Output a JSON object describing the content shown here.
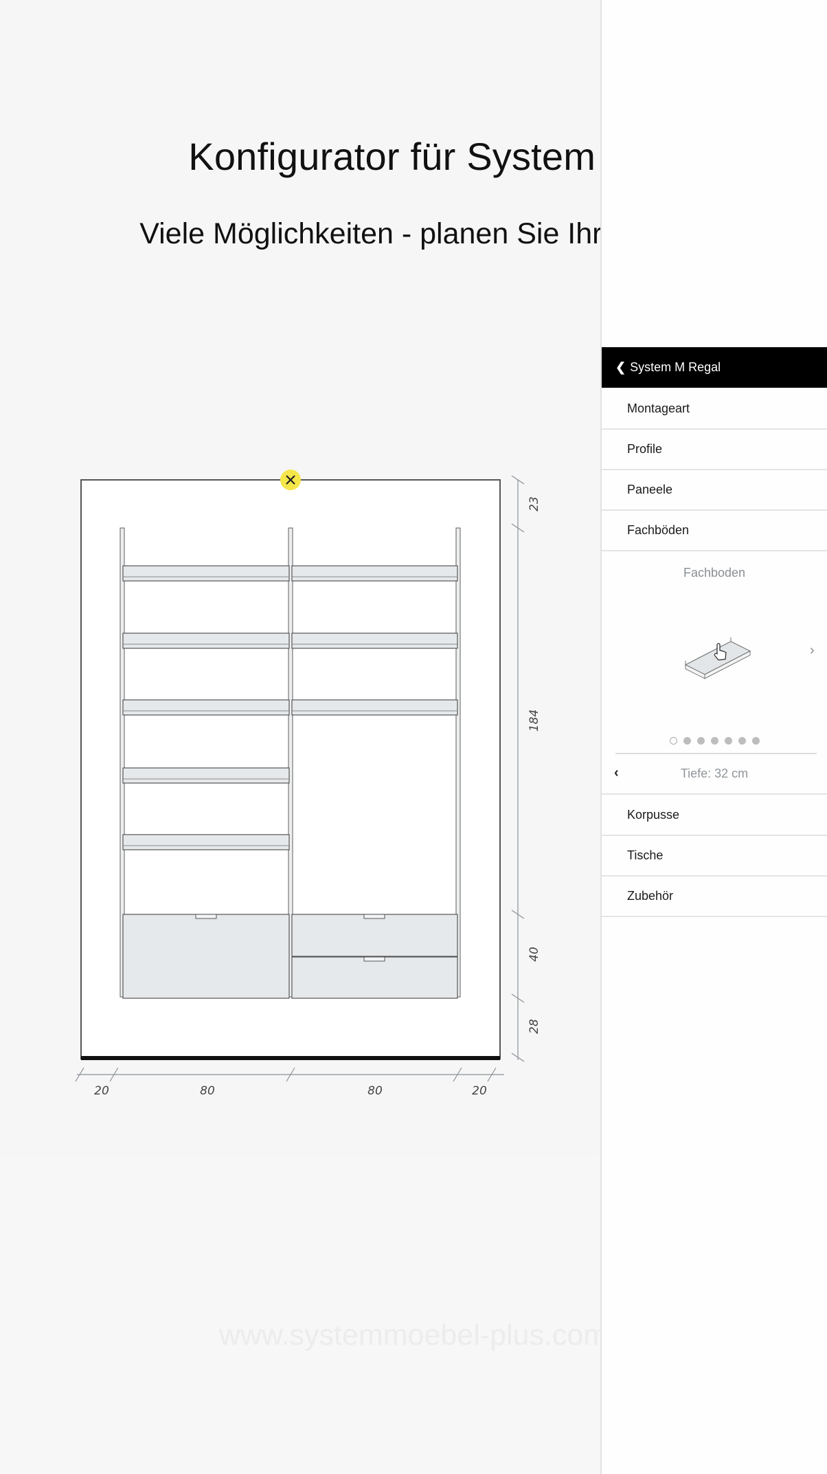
{
  "page": {
    "title": "Konfigurator für System M",
    "subtitle": "Viele Möglichkeiten - planen Sie Ihr Regal",
    "watermark": "www.systemmoebel-plus.com"
  },
  "sidebar": {
    "header": {
      "label": "System M Regal",
      "icon": "chevron-left-icon"
    },
    "items_top": [
      {
        "label": "Montageart"
      },
      {
        "label": "Profile"
      },
      {
        "label": "Paneele"
      },
      {
        "label": "Fachböden"
      }
    ],
    "detail": {
      "title": "Fachboden",
      "image": "shelf-board-icon",
      "next_icon": "chevron-right-icon",
      "carousel_total": 7,
      "carousel_active_index": 0
    },
    "depth": {
      "label": "Tiefe: 32 cm",
      "icon": "chevron-left-icon"
    },
    "items_bottom": [
      {
        "label": "Korpusse"
      },
      {
        "label": "Tische"
      },
      {
        "label": "Zubehör"
      }
    ]
  },
  "drawing": {
    "remove_icon": "close-icon",
    "accent_color": "#f5e64a",
    "columns_cm": [
      80,
      80
    ],
    "width_dims": [
      "20",
      "80",
      "80",
      "20"
    ],
    "height_dims": [
      "23",
      "184",
      "40",
      "28"
    ],
    "left_column_shelves": 5,
    "right_column_shelves": 3,
    "left_column_drawers": 1,
    "right_column_drawers": 2
  }
}
